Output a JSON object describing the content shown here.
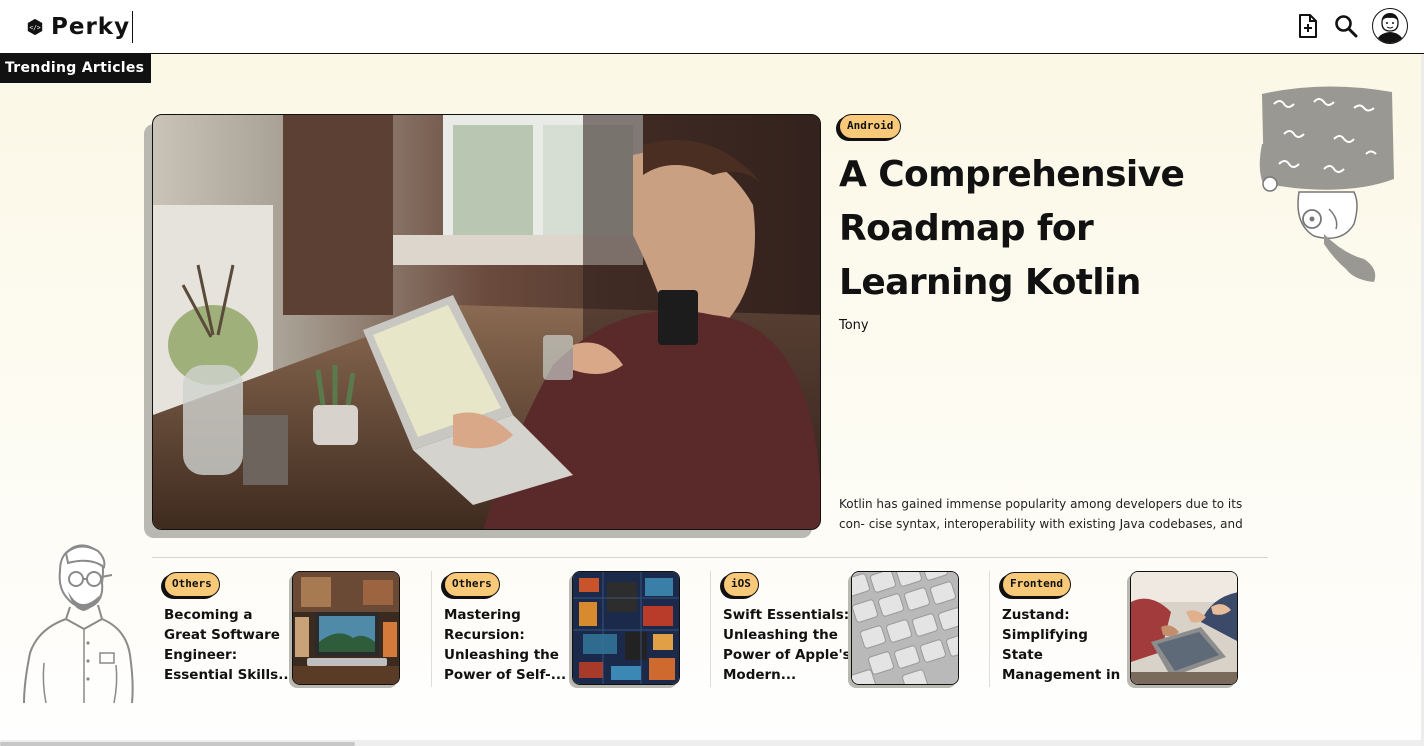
{
  "header": {
    "logo_text": "Perky",
    "icons": [
      "new-post-icon",
      "search-icon",
      "avatar"
    ]
  },
  "section": {
    "title": "Trending Articles"
  },
  "hero": {
    "tag": "Android",
    "title": "A Comprehensive Roadmap for Learning Kotlin",
    "author": "Tony",
    "excerpt": "Kotlin has gained immense popularity among developers due to its con- cise syntax, interoperability with existing Java codebases, and powerful..."
  },
  "cards": [
    {
      "tag": "Others",
      "title": "Becoming a Great Software Engineer: Essential Skills..."
    },
    {
      "tag": "Others",
      "title": "Mastering Recursion: Unleashing the Power of Self-..."
    },
    {
      "tag": "iOS",
      "title": "Swift Essentials: Unleashing the Power of Apple's Modern..."
    },
    {
      "tag": "Frontend",
      "title": "Zustand: Simplifying State Management in React..."
    }
  ],
  "colors": {
    "tag_bg": "#f7c978",
    "ink": "#111111",
    "page_bg": "#fbf7e4"
  }
}
